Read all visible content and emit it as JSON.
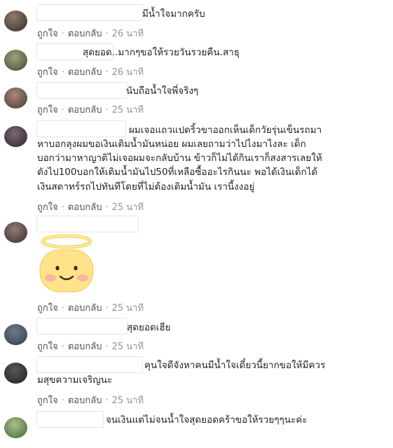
{
  "comments": [
    {
      "text": "มีน้ำใจมากครับ",
      "like_label": "ถูกใจ",
      "reply_label": "ตอบกลับ",
      "time": "26 นาที"
    },
    {
      "text": "สุดยอด..มากๆขอให้รวยวันรวยคืน.สาธุ",
      "like_label": "ถูกใจ",
      "reply_label": "ตอบกลับ",
      "time": "26 นาที"
    },
    {
      "text": "นับถือน้ำใจพี่จริงๆ",
      "like_label": "ถูกใจ",
      "reply_label": "ตอบกลับ",
      "time": "25 นาที"
    },
    {
      "lines": [
        "ผมเจอแถวแปดริ้วขาออกเห็นเด็กวัยรุ่นเข็นรถมา",
        "หาบอกลุงผมขอเงินเติมน้ำมันหน่อย ผมเลยถามว่าไปไงมาไงละ เด็ก",
        "บอกว่ามาหาญาติไม่เจอผมจะกลับบ้าน ข้าวก็ไม่ได้กินเราก็สงสารเลยให้",
        "ตังไป100บอกให้เติมน้ำมันไป50ที่เหลือซื้ออะไรกินนะ พอได้เงินเด็กได้",
        "เงินสตาทร์รถไปทันทีโดยที่ไม่ต้องเติมน้ำมัน เรานี้งงอยู่"
      ],
      "like_label": "ถูกใจ",
      "reply_label": "ตอบกลับ",
      "time": "25 นาที"
    },
    {
      "sticker": "angel-smiley",
      "like_label": "ถูกใจ",
      "reply_label": "ตอบกลับ",
      "time": "25 นาที"
    },
    {
      "text": "สุดยอดเฮีย",
      "like_label": "ถูกใจ",
      "reply_label": "ตอบกลับ",
      "time": "25 นาที"
    },
    {
      "lines": [
        "คุนใจดีจังหาคนมีน้ำใจเดี๋ยวนี้ยากขอให้มีควร",
        "มสุขความเจริญนะ"
      ],
      "like_label": "ถูกใจ",
      "reply_label": "ตอบกลับ",
      "time": "25 นาที"
    },
    {
      "text": "จนเงินแต่ไม่จนน้ำใจสุดยอดคร้าขอให้รวยๆๆนะค่ะ"
    }
  ],
  "colors": {
    "text": "#1d2129",
    "meta": "#90949c",
    "link": "#4b4f56"
  }
}
